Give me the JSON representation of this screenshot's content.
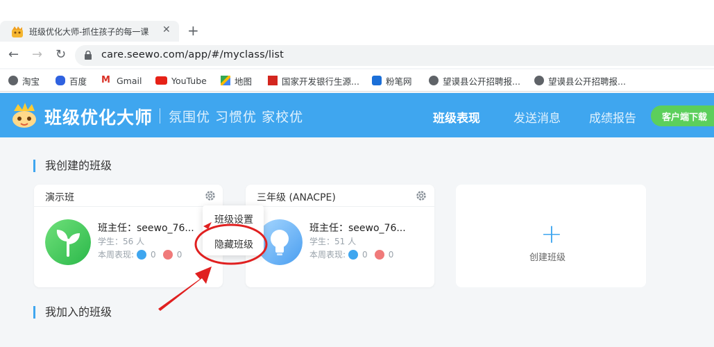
{
  "browser": {
    "tab_title": "班级优化大师-抓住孩子的每一课",
    "tab_close": "✕",
    "new_tab": "+",
    "url": "care.seewo.com/app/#/myclass/list",
    "bookmarks": [
      "淘宝",
      "百度",
      "Gmail",
      "YouTube",
      "地图",
      "国家开发银行生源...",
      "粉笔网",
      "望谟县公开招聘报...",
      "望谟县公开招聘报..."
    ]
  },
  "header": {
    "brand": "班级优化大师",
    "slogan": "氛围优 习惯优 家校优",
    "nav": [
      "班级表现",
      "发送消息",
      "成绩报告"
    ],
    "download": "客户端下载"
  },
  "sections": {
    "created": "我创建的班级",
    "joined": "我加入的班级"
  },
  "classes": [
    {
      "name": "演示班",
      "teacher": "班主任：seewo_76...",
      "students": "学生：56 人",
      "perf_label": "本周表现:",
      "good": "0",
      "bad": "0"
    },
    {
      "name": "三年级 (ANACPE)",
      "teacher": "班主任：seewo_76...",
      "students": "学生：51 人",
      "perf_label": "本周表现:",
      "good": "0",
      "bad": "0"
    }
  ],
  "create_card": {
    "label": "创建班级",
    "plus": "+"
  },
  "popup": {
    "items": [
      "班级设置",
      "隐藏班级"
    ]
  },
  "colors": {
    "header": "#3fa6ef",
    "download": "#5ccf5c",
    "annotation": "#e02020"
  }
}
